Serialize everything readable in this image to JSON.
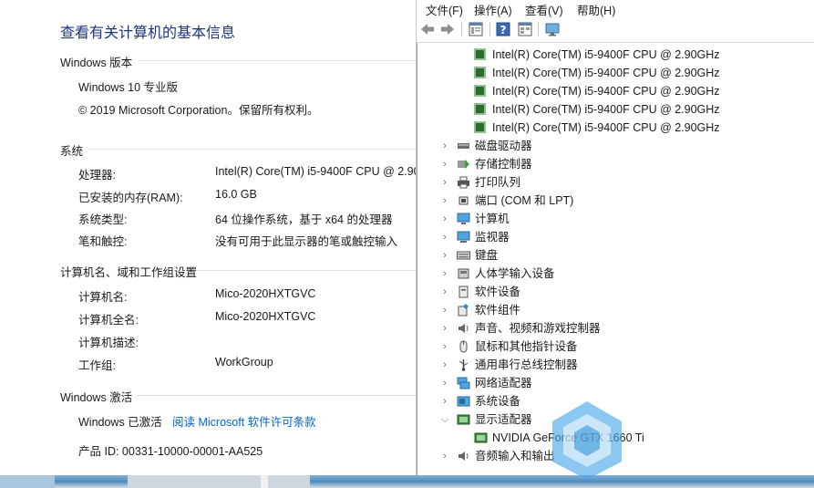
{
  "sysinfo": {
    "title": "查看有关计算机的基本信息",
    "windows_edition": {
      "heading": "Windows 版本",
      "edition": "Windows 10 专业版",
      "copyright": "© 2019 Microsoft Corporation。保留所有权利。"
    },
    "system": {
      "heading": "系统",
      "rows": [
        {
          "label": "处理器:",
          "value": "Intel(R) Core(TM) i5-9400F CPU @ 2.90"
        },
        {
          "label": "已安装的内存(RAM):",
          "value": "16.0 GB"
        },
        {
          "label": "系统类型:",
          "value": "64 位操作系统，基于 x64 的处理器"
        },
        {
          "label": "笔和触控:",
          "value": "没有可用于此显示器的笔或触控输入"
        }
      ]
    },
    "computer": {
      "heading": "计算机名、域和工作组设置",
      "rows": [
        {
          "label": "计算机名:",
          "value": "Mico-2020HXTGVC"
        },
        {
          "label": "计算机全名:",
          "value": "Mico-2020HXTGVC"
        },
        {
          "label": "计算机描述:",
          "value": ""
        },
        {
          "label": "工作组:",
          "value": "WorkGroup"
        }
      ]
    },
    "activation": {
      "heading": "Windows 激活",
      "status": "Windows 已激活",
      "link": "阅读 Microsoft 软件许可条款",
      "product_id": "产品 ID: 00331-10000-00001-AA525"
    }
  },
  "devmgr": {
    "menu": [
      "文件(F)",
      "操作(A)",
      "查看(V)",
      "帮助(H)"
    ],
    "toolbar_icons": [
      "back-icon",
      "forward-icon",
      "properties-icon",
      "help-icon",
      "view-icon",
      "monitor-icon"
    ],
    "processors": [
      "Intel(R) Core(TM) i5-9400F CPU @ 2.90GHz",
      "Intel(R) Core(TM) i5-9400F CPU @ 2.90GHz",
      "Intel(R) Core(TM) i5-9400F CPU @ 2.90GHz",
      "Intel(R) Core(TM) i5-9400F CPU @ 2.90GHz",
      "Intel(R) Core(TM) i5-9400F CPU @ 2.90GHz"
    ],
    "categories": [
      {
        "label": "磁盘驱动器",
        "icon": "disk-drive-icon",
        "expanded": false
      },
      {
        "label": "存储控制器",
        "icon": "storage-controller-icon",
        "expanded": false
      },
      {
        "label": "打印队列",
        "icon": "printer-icon",
        "expanded": false
      },
      {
        "label": "端口 (COM 和 LPT)",
        "icon": "port-icon",
        "expanded": false
      },
      {
        "label": "计算机",
        "icon": "computer-icon",
        "expanded": false
      },
      {
        "label": "监视器",
        "icon": "monitor-icon",
        "expanded": false
      },
      {
        "label": "键盘",
        "icon": "keyboard-icon",
        "expanded": false
      },
      {
        "label": "人体学输入设备",
        "icon": "hid-icon",
        "expanded": false
      },
      {
        "label": "软件设备",
        "icon": "software-device-icon",
        "expanded": false
      },
      {
        "label": "软件组件",
        "icon": "software-component-icon",
        "expanded": false
      },
      {
        "label": "声音、视频和游戏控制器",
        "icon": "speaker-icon",
        "expanded": false
      },
      {
        "label": "鼠标和其他指针设备",
        "icon": "mouse-icon",
        "expanded": false
      },
      {
        "label": "通用串行总线控制器",
        "icon": "usb-icon",
        "expanded": false
      },
      {
        "label": "网络适配器",
        "icon": "network-adapter-icon",
        "expanded": false
      },
      {
        "label": "系统设备",
        "icon": "system-device-icon",
        "expanded": false
      },
      {
        "label": "显示适配器",
        "icon": "display-adapter-icon",
        "expanded": true
      },
      {
        "label": "音频输入和输出",
        "icon": "audio-io-icon",
        "expanded": false
      }
    ],
    "display_child": "NVIDIA GeForce GTX 1660 Ti"
  },
  "colors": {
    "title_blue": "#1e3287",
    "link_blue": "#0066cc"
  }
}
